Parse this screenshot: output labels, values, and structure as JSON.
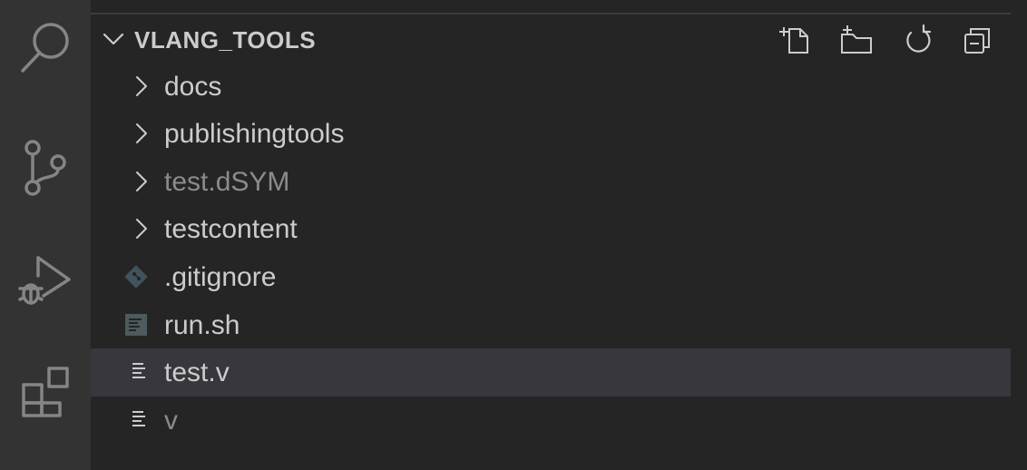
{
  "activity_bar": {
    "items": [
      {
        "name": "search",
        "icon": "search-icon"
      },
      {
        "name": "source-control",
        "icon": "source-control-icon"
      },
      {
        "name": "run-debug",
        "icon": "run-debug-icon"
      },
      {
        "name": "extensions",
        "icon": "extensions-icon"
      }
    ]
  },
  "explorer": {
    "folder_title": "VLANG_TOOLS",
    "actions": [
      "new-file-icon",
      "new-folder-icon",
      "refresh-icon",
      "collapse-all-icon"
    ],
    "items": [
      {
        "label": "docs",
        "type": "folder"
      },
      {
        "label": "publishingtools",
        "type": "folder"
      },
      {
        "label": "test.dSYM",
        "type": "folder",
        "dimmed": true
      },
      {
        "label": "testcontent",
        "type": "folder"
      },
      {
        "label": ".gitignore",
        "type": "file",
        "icon": "git-file-icon"
      },
      {
        "label": "run.sh",
        "type": "file",
        "icon": "shell-file-icon"
      },
      {
        "label": "test.v",
        "type": "file",
        "icon": "text-file-icon",
        "selected": true
      },
      {
        "label": "v",
        "type": "file",
        "icon": "text-file-icon",
        "dimmed": true
      }
    ]
  },
  "colors": {
    "activity_bg": "#333333",
    "sidebar_bg": "#252526",
    "selection_bg": "#37373d",
    "icon_inactive": "#858585",
    "text": "#cccccc",
    "text_dimmed": "#8b8b8b"
  }
}
